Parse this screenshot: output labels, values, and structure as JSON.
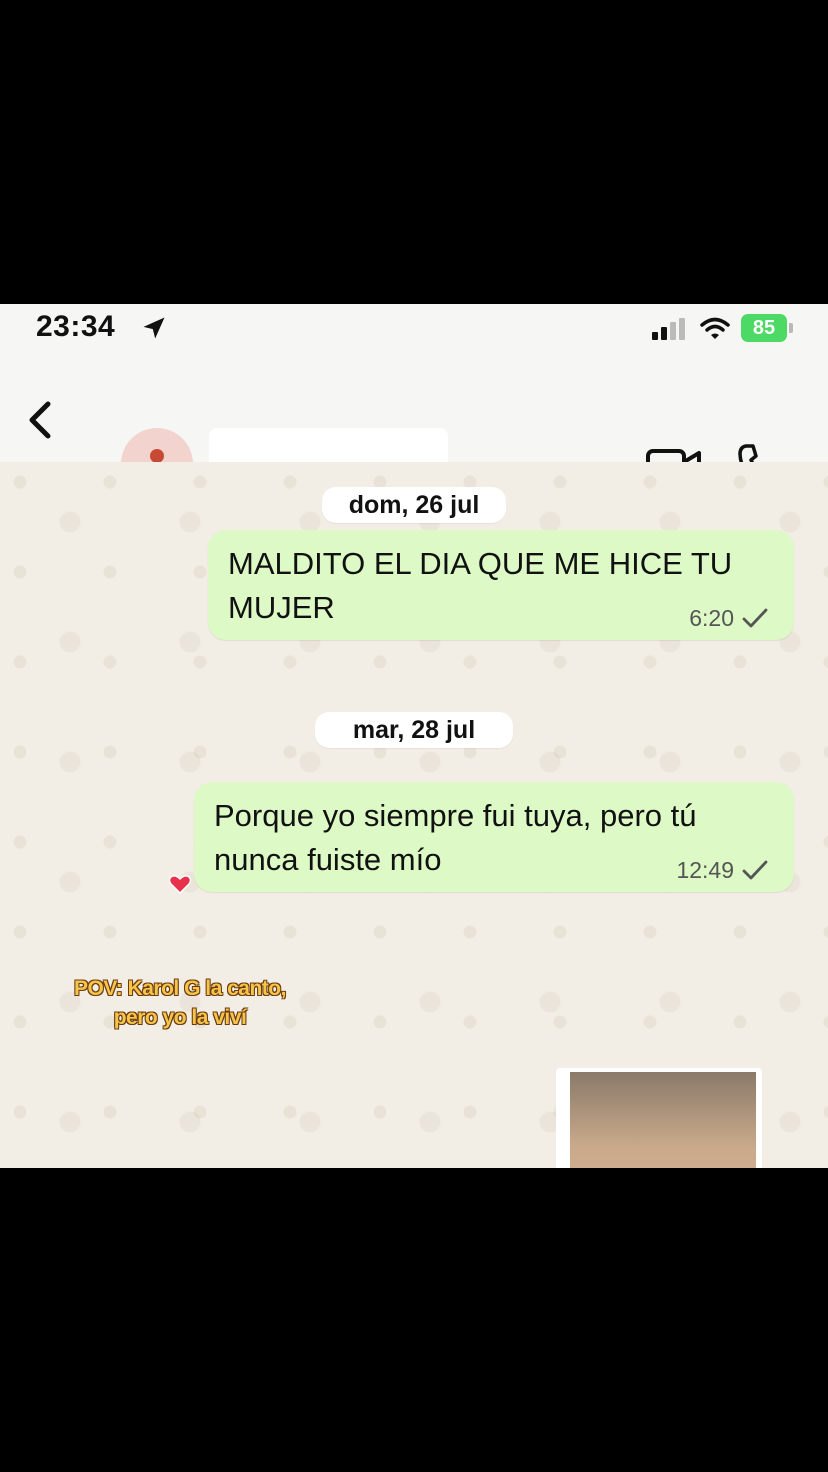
{
  "status_bar": {
    "time": "23:34",
    "battery": "85"
  },
  "header": {
    "contact_name": "."
  },
  "chat": {
    "messages": [
      {
        "date": "dom, 26 jul",
        "text": "MALDITO EL DIA QUE ME HICE TU MUJER",
        "time": "6:20"
      },
      {
        "date": "mar, 28 jul",
        "text": "Porque yo siempre fui tuya, pero tú nunca fuiste mío",
        "time": "12:49"
      }
    ],
    "overlay_caption": "POV: Karol G la canto, pero yo la viví"
  },
  "icons": {
    "back": "chevron-left-icon",
    "avatar": "person-icon",
    "video": "video-camera-icon",
    "call": "phone-icon",
    "read": "checkmark-icon",
    "overlay": "heart-icon"
  },
  "colors": {
    "bubble_outgoing": "#dcf9c6",
    "battery": "#4cd964",
    "avatar_bg": "#f3d3cd"
  }
}
